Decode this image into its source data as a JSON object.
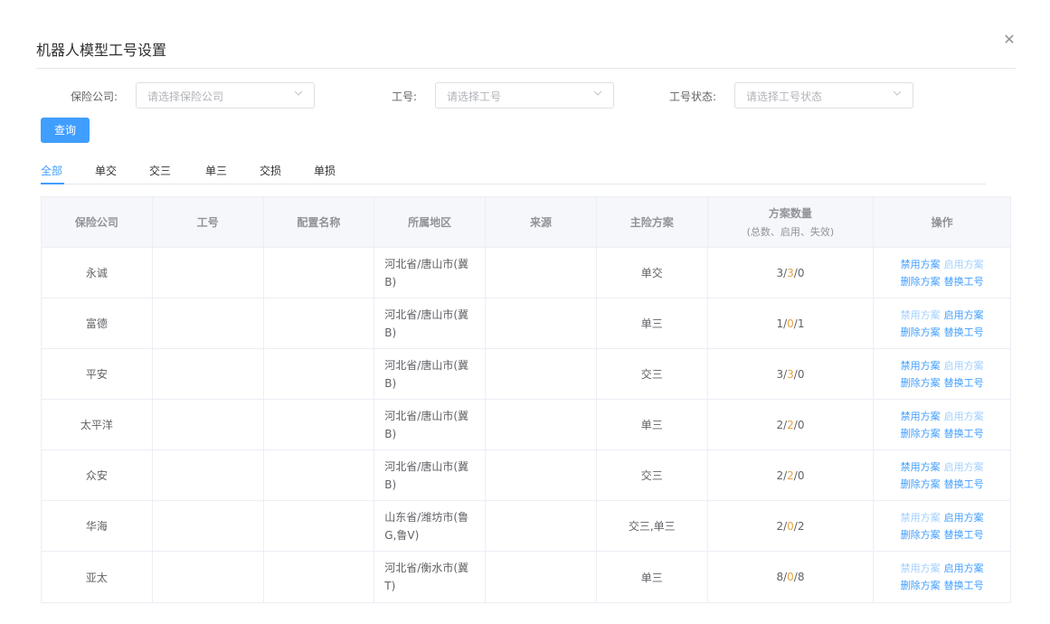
{
  "dialog": {
    "title": "机器人模型工号设置",
    "close_icon": "close-icon"
  },
  "filters": {
    "company": {
      "label": "保险公司:",
      "placeholder": "请选择保险公司"
    },
    "worker_id": {
      "label": "工号:",
      "placeholder": "请选择工号"
    },
    "status": {
      "label": "工号状态:",
      "placeholder": "请选择工号状态"
    },
    "query_label": "查询"
  },
  "tabs": [
    {
      "label": "全部",
      "active": true
    },
    {
      "label": "单交",
      "active": false
    },
    {
      "label": "交三",
      "active": false
    },
    {
      "label": "单三",
      "active": false
    },
    {
      "label": "交损",
      "active": false
    },
    {
      "label": "单损",
      "active": false
    }
  ],
  "table": {
    "headers": [
      "保险公司",
      "工号",
      "配置名称",
      "所属地区",
      "来源",
      "主险方案",
      "方案数量",
      "操作"
    ],
    "count_subheader": "(总数、启用、失效)",
    "action_labels": {
      "disable": "禁用方案",
      "enable": "启用方案",
      "delete": "删除方案",
      "replace": "替换工号"
    },
    "rows": [
      {
        "company": "永诚",
        "worker_id": "",
        "config": "",
        "region": "河北省/唐山市(冀B)",
        "source": "",
        "plan": "单交",
        "total": "3",
        "enabled": "3",
        "invalid": "0",
        "disable_active": true,
        "enable_active": false
      },
      {
        "company": "富德",
        "worker_id": "",
        "config": "",
        "region": "河北省/唐山市(冀B)",
        "source": "",
        "plan": "单三",
        "total": "1",
        "enabled": "0",
        "invalid": "1",
        "disable_active": false,
        "enable_active": true
      },
      {
        "company": "平安",
        "worker_id": "",
        "config": "",
        "region": "河北省/唐山市(冀B)",
        "source": "",
        "plan": "交三",
        "total": "3",
        "enabled": "3",
        "invalid": "0",
        "disable_active": true,
        "enable_active": false
      },
      {
        "company": "太平洋",
        "worker_id": "",
        "config": "",
        "region": "河北省/唐山市(冀B)",
        "source": "",
        "plan": "单三",
        "total": "2",
        "enabled": "2",
        "invalid": "0",
        "disable_active": true,
        "enable_active": false
      },
      {
        "company": "众安",
        "worker_id": "",
        "config": "",
        "region": "河北省/唐山市(冀B)",
        "source": "",
        "plan": "交三",
        "total": "2",
        "enabled": "2",
        "invalid": "0",
        "disable_active": true,
        "enable_active": false
      },
      {
        "company": "华海",
        "worker_id": "",
        "config": "",
        "region": "山东省/潍坊市(鲁G,鲁V)",
        "source": "",
        "plan": "交三,单三",
        "total": "2",
        "enabled": "0",
        "invalid": "2",
        "disable_active": false,
        "enable_active": true
      },
      {
        "company": "亚太",
        "worker_id": "",
        "config": "",
        "region": "河北省/衡水市(冀T)",
        "source": "",
        "plan": "单三",
        "total": "8",
        "enabled": "0",
        "invalid": "8",
        "disable_active": false,
        "enable_active": true
      }
    ]
  },
  "colors": {
    "primary": "#409eff",
    "primary_light": "#a0cfff",
    "warning": "#e6a23c",
    "border": "#ebeef5",
    "header_bg": "#f5f7fa"
  }
}
